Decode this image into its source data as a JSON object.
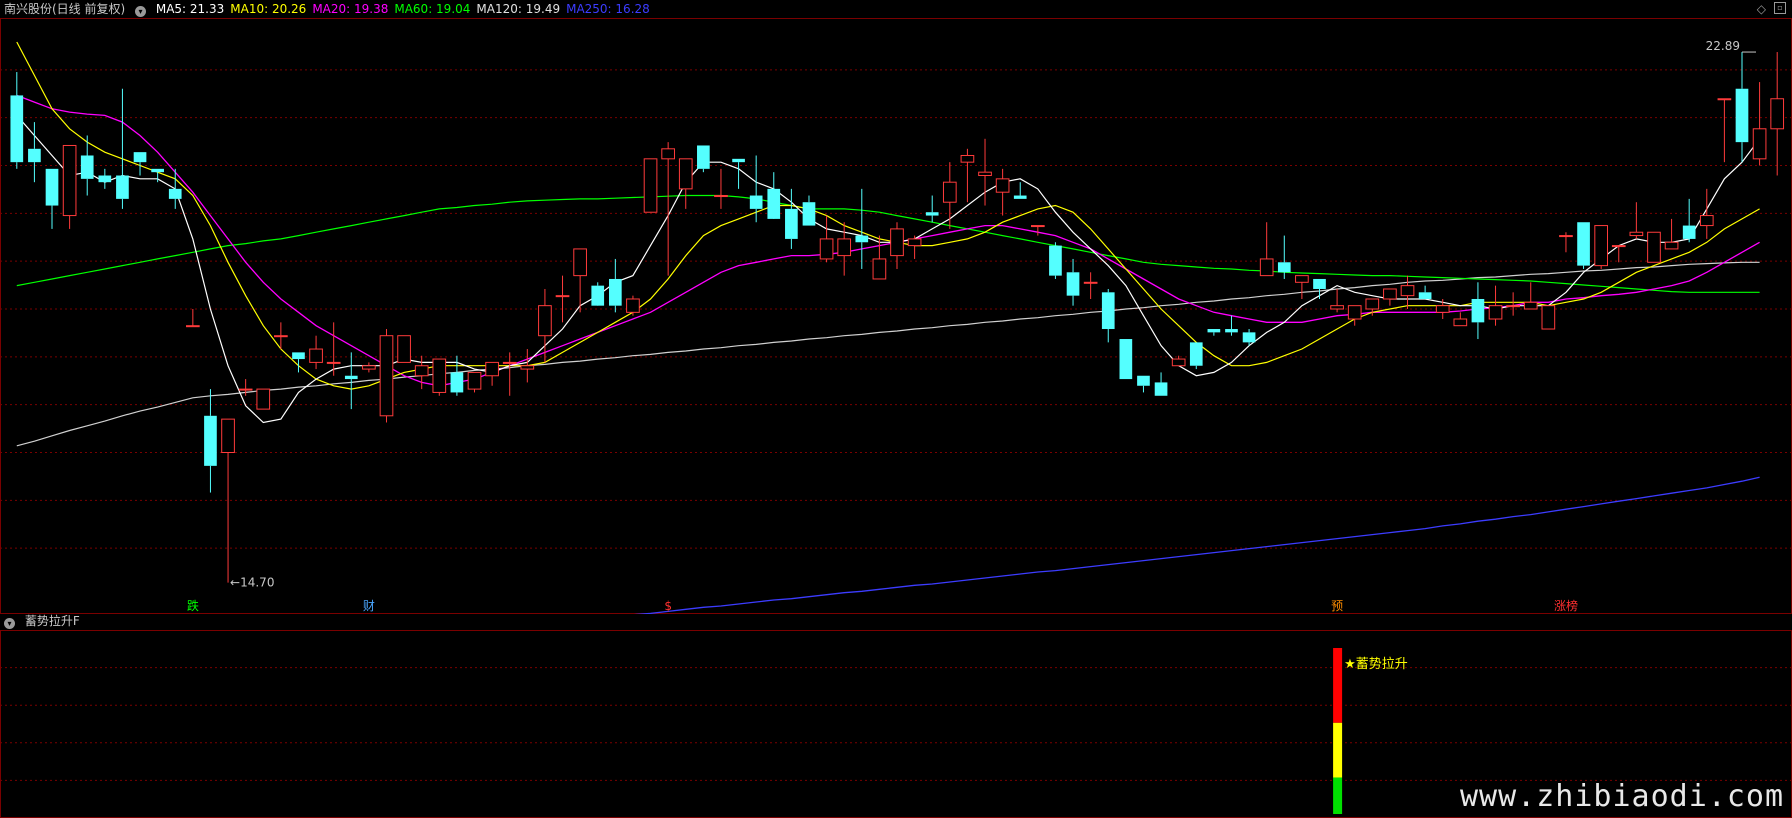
{
  "header": {
    "title": "南兴股份(日线 前复权)",
    "ma": [
      {
        "label": "MA5: 21.33",
        "color": "#ffffff"
      },
      {
        "label": "MA10: 20.26",
        "color": "#ffff00"
      },
      {
        "label": "MA20: 19.38",
        "color": "#ff00ff"
      },
      {
        "label": "MA60: 19.04",
        "color": "#00ff00"
      },
      {
        "label": "MA120: 19.49",
        "color": "#e0e0e0"
      },
      {
        "label": "MA250: 16.28",
        "color": "#3c3cff"
      }
    ]
  },
  "price_labels": {
    "high": "22.89",
    "low": "14.70"
  },
  "event_markers": [
    {
      "label": "跌",
      "color": "#00ff00",
      "x": 10
    },
    {
      "label": "财",
      "color": "#4aa6ff",
      "x": 20
    },
    {
      "label": "$",
      "color": "#ff3030",
      "x": 37
    },
    {
      "label": "预",
      "color": "#ff8c00",
      "x": 75
    },
    {
      "label": "涨榜",
      "color": "#ff3030",
      "x": 88
    }
  ],
  "indicator": {
    "title": "蓄势拉升F",
    "signal_label": "★蓄势拉升",
    "bar_levels": {
      "red": 0.45,
      "yellow": 0.33,
      "green": 0.22
    }
  },
  "watermark": "www.zhibiaodi.com",
  "colors": {
    "up": "#ff3b3b",
    "down": "#54ffff",
    "grid": "#7a0000",
    "ma5": "#ffffff",
    "ma10": "#ffff00",
    "ma20": "#ff00ff",
    "ma60": "#00ff00",
    "ma120": "#d0d0d0",
    "ma250": "#3c3cff"
  },
  "chart_data": {
    "type": "candlestick",
    "ylim": [
      14.5,
      23.1
    ],
    "ohlc": [
      [
        22.0,
        22.35,
        20.9,
        21.0
      ],
      [
        21.2,
        21.6,
        20.7,
        21.0
      ],
      [
        20.9,
        20.9,
        20.0,
        20.35
      ],
      [
        20.2,
        21.25,
        20.0,
        21.25
      ],
      [
        21.1,
        21.4,
        20.5,
        20.75
      ],
      [
        20.8,
        20.9,
        20.6,
        20.7
      ],
      [
        20.8,
        22.1,
        20.3,
        20.45
      ],
      [
        21.15,
        21.15,
        20.8,
        21.0
      ],
      [
        20.9,
        20.9,
        20.7,
        20.85
      ],
      [
        20.6,
        20.9,
        20.3,
        20.45
      ],
      [
        18.55,
        18.8,
        18.55,
        18.55
      ],
      [
        17.2,
        17.6,
        16.05,
        16.45
      ],
      [
        16.65,
        16.9,
        14.7,
        17.15
      ],
      [
        17.6,
        17.75,
        17.5,
        17.6
      ],
      [
        17.3,
        17.6,
        17.3,
        17.6
      ],
      [
        18.4,
        18.6,
        18.2,
        18.4
      ],
      [
        18.15,
        18.15,
        17.85,
        18.05
      ],
      [
        18.0,
        18.4,
        17.9,
        18.2
      ],
      [
        18.0,
        18.6,
        17.8,
        18.0
      ],
      [
        17.8,
        18.15,
        17.3,
        17.75
      ],
      [
        17.9,
        18.0,
        17.85,
        17.95
      ],
      [
        17.2,
        18.5,
        17.1,
        18.4
      ],
      [
        18.0,
        18.4,
        18.0,
        18.4
      ],
      [
        17.8,
        18.1,
        17.6,
        17.95
      ],
      [
        17.55,
        18.05,
        17.5,
        18.05
      ],
      [
        17.85,
        18.1,
        17.5,
        17.55
      ],
      [
        17.6,
        17.85,
        17.55,
        17.85
      ],
      [
        17.8,
        18.0,
        17.65,
        18.0
      ],
      [
        18.0,
        18.15,
        17.5,
        18.0
      ],
      [
        17.9,
        18.2,
        17.7,
        17.95
      ],
      [
        18.4,
        19.1,
        18.0,
        18.85
      ],
      [
        19.0,
        19.3,
        18.6,
        19.0
      ],
      [
        19.3,
        19.7,
        18.75,
        19.7
      ],
      [
        19.15,
        19.2,
        18.9,
        18.85
      ],
      [
        19.25,
        19.55,
        18.75,
        18.85
      ],
      [
        18.75,
        19.0,
        18.7,
        18.95
      ],
      [
        20.25,
        21.0,
        20.25,
        21.05
      ],
      [
        21.05,
        21.3,
        19.3,
        21.2
      ],
      [
        20.6,
        21.05,
        20.3,
        21.05
      ],
      [
        21.25,
        21.25,
        20.85,
        20.9
      ],
      [
        20.5,
        20.9,
        20.3,
        20.5
      ],
      [
        21.05,
        21.05,
        20.6,
        21.0
      ],
      [
        20.5,
        21.1,
        20.1,
        20.3
      ],
      [
        20.6,
        20.85,
        20.2,
        20.15
      ],
      [
        20.3,
        20.6,
        19.7,
        19.85
      ],
      [
        20.4,
        20.5,
        20.05,
        20.05
      ],
      [
        19.55,
        20.2,
        19.5,
        19.85
      ],
      [
        19.6,
        20.1,
        19.3,
        19.85
      ],
      [
        19.9,
        20.6,
        19.4,
        19.8
      ],
      [
        19.25,
        19.9,
        19.25,
        19.55
      ],
      [
        19.6,
        20.1,
        19.4,
        20.0
      ],
      [
        19.75,
        19.9,
        19.55,
        19.85
      ],
      [
        20.25,
        20.5,
        20.1,
        20.2
      ],
      [
        20.4,
        21.0,
        20.0,
        20.7
      ],
      [
        21.0,
        21.2,
        20.4,
        21.1
      ],
      [
        20.8,
        21.35,
        20.35,
        20.85
      ],
      [
        20.55,
        20.9,
        20.2,
        20.75
      ],
      [
        20.5,
        20.7,
        20.45,
        20.45
      ],
      [
        20.05,
        20.05,
        19.9,
        20.05
      ],
      [
        19.75,
        19.8,
        19.25,
        19.3
      ],
      [
        19.35,
        19.55,
        18.85,
        19.0
      ],
      [
        19.2,
        19.35,
        18.95,
        19.2
      ],
      [
        19.05,
        19.1,
        18.3,
        18.5
      ],
      [
        18.35,
        18.35,
        17.75,
        17.75
      ],
      [
        17.8,
        17.8,
        17.55,
        17.65
      ],
      [
        17.7,
        17.85,
        17.5,
        17.5
      ],
      [
        17.95,
        18.1,
        17.95,
        18.05
      ],
      [
        18.3,
        18.3,
        17.9,
        17.95
      ],
      [
        18.5,
        18.5,
        18.4,
        18.45
      ],
      [
        18.5,
        18.7,
        18.4,
        18.45
      ],
      [
        18.45,
        18.5,
        18.25,
        18.3
      ],
      [
        19.3,
        20.1,
        19.3,
        19.55
      ],
      [
        19.5,
        19.9,
        19.25,
        19.35
      ],
      [
        19.2,
        19.2,
        18.95,
        19.3
      ],
      [
        19.25,
        19.25,
        18.95,
        19.1
      ],
      [
        18.8,
        19.1,
        18.75,
        18.85
      ],
      [
        18.65,
        18.8,
        18.55,
        18.85
      ],
      [
        18.8,
        18.95,
        18.7,
        18.95
      ],
      [
        18.95,
        19.05,
        18.85,
        19.1
      ],
      [
        19.0,
        19.3,
        18.8,
        19.15
      ],
      [
        19.05,
        19.15,
        18.95,
        18.95
      ],
      [
        18.75,
        18.95,
        18.65,
        18.85
      ],
      [
        18.55,
        18.75,
        18.55,
        18.65
      ],
      [
        18.95,
        19.2,
        18.35,
        18.6
      ],
      [
        18.65,
        19.15,
        18.55,
        18.85
      ],
      [
        18.85,
        19.05,
        18.7,
        18.85
      ],
      [
        18.8,
        19.2,
        18.9,
        18.9
      ],
      [
        18.5,
        18.85,
        18.5,
        18.85
      ],
      [
        19.9,
        19.95,
        19.65,
        19.9
      ],
      [
        20.1,
        20.1,
        19.4,
        19.45
      ],
      [
        19.45,
        20.05,
        19.4,
        20.05
      ],
      [
        19.75,
        19.75,
        19.5,
        19.75
      ],
      [
        19.9,
        20.4,
        19.85,
        19.95
      ],
      [
        19.5,
        19.9,
        19.65,
        19.95
      ],
      [
        19.7,
        20.15,
        19.75,
        19.8
      ],
      [
        20.05,
        20.45,
        19.8,
        19.85
      ],
      [
        20.05,
        20.6,
        19.85,
        20.2
      ],
      [
        21.95,
        21.95,
        21.0,
        21.95
      ],
      [
        22.1,
        22.65,
        21.0,
        21.3
      ],
      [
        21.05,
        22.2,
        20.95,
        21.5
      ],
      [
        21.5,
        22.65,
        20.8,
        21.95
      ]
    ],
    "ma5": [
      21.7,
      21.4,
      21.1,
      20.8,
      20.85,
      20.7,
      20.8,
      20.75,
      20.75,
      20.6,
      19.85,
      18.8,
      17.95,
      17.35,
      17.1,
      17.15,
      17.55,
      17.75,
      17.9,
      17.95,
      17.95,
      17.95,
      18.05,
      18.0,
      18.0,
      18.0,
      17.9,
      17.85,
      17.95,
      18.0,
      18.25,
      18.5,
      18.85,
      19.0,
      19.2,
      19.3,
      19.75,
      20.2,
      20.7,
      21.0,
      21.0,
      20.9,
      20.7,
      20.6,
      20.4,
      20.15,
      20.0,
      19.95,
      19.9,
      19.8,
      19.8,
      19.85,
      20.0,
      20.15,
      20.35,
      20.55,
      20.7,
      20.75,
      20.6,
      20.25,
      19.95,
      19.7,
      19.45,
      19.15,
      18.7,
      18.25,
      17.95,
      17.8,
      17.85,
      18.0,
      18.25,
      18.45,
      18.6,
      18.85,
      19.0,
      19.15,
      19.05,
      19.0,
      18.95,
      18.95,
      18.95,
      18.9,
      18.85,
      18.85,
      18.8,
      18.85,
      18.85,
      18.85,
      19.05,
      19.35,
      19.55,
      19.75,
      19.85,
      19.8,
      19.8,
      19.85,
      20.3,
      20.75,
      21.0,
      21.35
    ],
    "ma10": [
      22.8,
      22.3,
      21.8,
      21.5,
      21.3,
      21.15,
      21.05,
      20.95,
      20.85,
      20.75,
      20.5,
      20.05,
      19.5,
      19.0,
      18.55,
      18.2,
      17.95,
      17.75,
      17.65,
      17.6,
      17.65,
      17.75,
      17.85,
      17.9,
      17.95,
      17.95,
      17.95,
      17.95,
      17.95,
      17.95,
      18.0,
      18.15,
      18.3,
      18.45,
      18.6,
      18.75,
      18.95,
      19.25,
      19.6,
      19.9,
      20.05,
      20.15,
      20.25,
      20.35,
      20.35,
      20.3,
      20.2,
      20.05,
      19.95,
      19.85,
      19.8,
      19.75,
      19.75,
      19.8,
      19.85,
      19.95,
      20.1,
      20.2,
      20.3,
      20.35,
      20.25,
      20.0,
      19.7,
      19.4,
      19.1,
      18.8,
      18.55,
      18.3,
      18.1,
      17.95,
      17.95,
      18.0,
      18.1,
      18.2,
      18.35,
      18.5,
      18.65,
      18.75,
      18.8,
      18.85,
      18.85,
      18.85,
      18.85,
      18.9,
      18.9,
      18.9,
      18.9,
      18.85,
      18.9,
      18.95,
      19.05,
      19.2,
      19.35,
      19.45,
      19.55,
      19.65,
      19.8,
      20.0,
      20.15,
      20.3
    ],
    "ma20": [
      22.0,
      21.9,
      21.8,
      21.75,
      21.72,
      21.7,
      21.6,
      21.4,
      21.15,
      20.85,
      20.55,
      20.2,
      19.85,
      19.5,
      19.2,
      18.95,
      18.75,
      18.55,
      18.4,
      18.25,
      18.1,
      17.95,
      17.8,
      17.7,
      17.65,
      17.7,
      17.75,
      17.85,
      17.95,
      18.05,
      18.15,
      18.25,
      18.35,
      18.45,
      18.55,
      18.65,
      18.75,
      18.9,
      19.05,
      19.2,
      19.35,
      19.45,
      19.5,
      19.55,
      19.6,
      19.6,
      19.62,
      19.65,
      19.7,
      19.75,
      19.8,
      19.85,
      19.9,
      19.95,
      20.0,
      20.05,
      20.05,
      20.0,
      19.95,
      19.9,
      19.8,
      19.7,
      19.55,
      19.4,
      19.25,
      19.1,
      18.95,
      18.85,
      18.75,
      18.7,
      18.65,
      18.6,
      18.6,
      18.6,
      18.65,
      18.7,
      18.72,
      18.75,
      18.75,
      18.75,
      18.75,
      18.75,
      18.77,
      18.8,
      18.82,
      18.85,
      18.9,
      18.9,
      18.95,
      18.97,
      19.0,
      19.02,
      19.05,
      19.1,
      19.15,
      19.22,
      19.35,
      19.5,
      19.65,
      19.8
    ],
    "ma60": [
      19.15,
      19.2,
      19.25,
      19.3,
      19.35,
      19.4,
      19.45,
      19.5,
      19.55,
      19.6,
      19.65,
      19.7,
      19.75,
      19.78,
      19.82,
      19.85,
      19.9,
      19.95,
      20.0,
      20.05,
      20.1,
      20.15,
      20.2,
      20.25,
      20.3,
      20.32,
      20.35,
      20.37,
      20.4,
      20.42,
      20.43,
      20.44,
      20.45,
      20.45,
      20.46,
      20.47,
      20.48,
      20.49,
      20.5,
      20.5,
      20.5,
      20.48,
      20.45,
      20.4,
      20.35,
      20.3,
      20.3,
      20.3,
      20.28,
      20.25,
      20.2,
      20.15,
      20.1,
      20.05,
      20.0,
      19.95,
      19.9,
      19.85,
      19.8,
      19.75,
      19.7,
      19.65,
      19.6,
      19.55,
      19.5,
      19.47,
      19.45,
      19.43,
      19.41,
      19.4,
      19.38,
      19.37,
      19.35,
      19.34,
      19.33,
      19.32,
      19.31,
      19.3,
      19.3,
      19.29,
      19.28,
      19.27,
      19.26,
      19.25,
      19.24,
      19.23,
      19.22,
      19.2,
      19.18,
      19.16,
      19.14,
      19.12,
      19.1,
      19.08,
      19.06,
      19.05,
      19.05,
      19.05,
      19.05,
      19.05
    ],
    "ma120": [
      16.75,
      16.82,
      16.9,
      16.98,
      17.05,
      17.12,
      17.2,
      17.27,
      17.33,
      17.4,
      17.47,
      17.5,
      17.52,
      17.55,
      17.58,
      17.6,
      17.63,
      17.65,
      17.68,
      17.7,
      17.73,
      17.75,
      17.78,
      17.8,
      17.83,
      17.85,
      17.88,
      17.9,
      17.92,
      17.95,
      17.97,
      18.0,
      18.02,
      18.05,
      18.07,
      18.1,
      18.12,
      18.15,
      18.17,
      18.2,
      18.22,
      18.25,
      18.27,
      18.3,
      18.32,
      18.35,
      18.37,
      18.4,
      18.42,
      18.45,
      18.47,
      18.5,
      18.52,
      18.55,
      18.57,
      18.6,
      18.62,
      18.65,
      18.67,
      18.7,
      18.72,
      18.75,
      18.77,
      18.8,
      18.82,
      18.85,
      18.87,
      18.9,
      18.92,
      18.95,
      18.97,
      19.0,
      19.02,
      19.05,
      19.07,
      19.1,
      19.12,
      19.15,
      19.17,
      19.2,
      19.22,
      19.23,
      19.25,
      19.27,
      19.28,
      19.3,
      19.32,
      19.33,
      19.35,
      19.37,
      19.38,
      19.4,
      19.42,
      19.43,
      19.45,
      19.47,
      19.48,
      19.49,
      19.5,
      19.5
    ],
    "ma250": [
      null,
      null,
      null,
      null,
      null,
      null,
      null,
      null,
      null,
      null,
      null,
      null,
      null,
      null,
      null,
      null,
      null,
      null,
      null,
      null,
      null,
      null,
      null,
      null,
      null,
      13.95,
      13.98,
      14.0,
      14.03,
      14.06,
      14.08,
      14.11,
      14.14,
      14.16,
      14.19,
      14.22,
      14.24,
      14.27,
      14.3,
      14.33,
      14.35,
      14.38,
      14.41,
      14.44,
      14.46,
      14.49,
      14.52,
      14.55,
      14.57,
      14.6,
      14.63,
      14.66,
      14.68,
      14.71,
      14.74,
      14.77,
      14.8,
      14.83,
      14.86,
      14.88,
      14.91,
      14.94,
      14.97,
      15.0,
      15.03,
      15.06,
      15.09,
      15.12,
      15.15,
      15.18,
      15.21,
      15.24,
      15.27,
      15.3,
      15.33,
      15.36,
      15.39,
      15.42,
      15.45,
      15.48,
      15.51,
      15.55,
      15.58,
      15.62,
      15.65,
      15.69,
      15.72,
      15.76,
      15.8,
      15.84,
      15.88,
      15.92,
      15.96,
      16.0,
      16.04,
      16.08,
      16.12,
      16.17,
      16.22,
      16.28
    ]
  }
}
